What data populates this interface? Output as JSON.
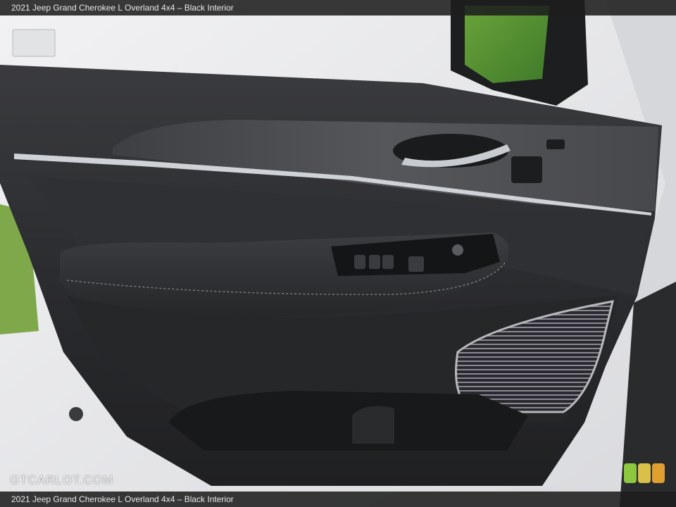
{
  "caption": {
    "top": "2021 Jeep Grand Cherokee L Overland 4x4 – Black Interior",
    "bottom": "2021 Jeep Grand Cherokee L Overland 4x4 – Black Interior"
  },
  "watermark": {
    "text": "GTCARLOT.COM"
  },
  "colors": {
    "caption_bg": "#1e1e1e",
    "door_panel": "#2b2c2e",
    "wood_trim": "#4a4c4f",
    "chrome": "#c9ccd0",
    "badge_green": "#8dc63f",
    "badge_yellow": "#d8c04a",
    "badge_orange": "#e0a030"
  }
}
